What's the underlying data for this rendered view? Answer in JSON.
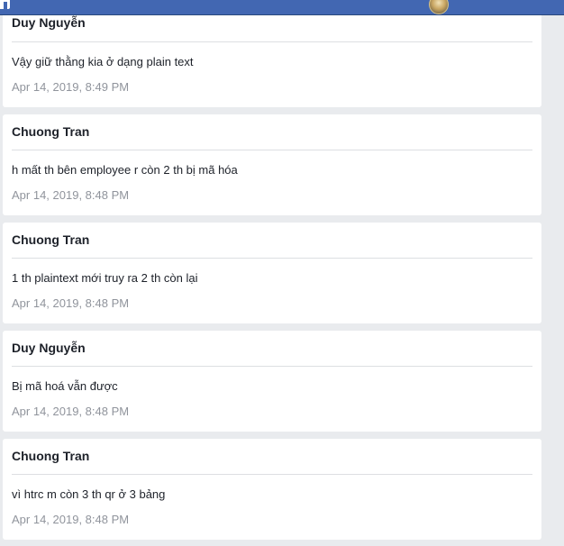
{
  "header": {
    "logo_icon": "facebook-logo-icon",
    "avatar_icon": "profile-avatar-icon"
  },
  "messages": [
    {
      "author": "Duy Nguyễn",
      "text": "Vậy giữ thằng kia ở dạng plain text",
      "timestamp": "Apr 14, 2019, 8:49 PM"
    },
    {
      "author": "Chuong Tran",
      "text": "h mất th bên employee r còn 2 th bị mã hóa",
      "timestamp": "Apr 14, 2019, 8:48 PM"
    },
    {
      "author": "Chuong Tran",
      "text": "1 th plaintext mới truy ra 2 th còn lại",
      "timestamp": "Apr 14, 2019, 8:48 PM"
    },
    {
      "author": "Duy Nguyễn",
      "text": "Bị mã hoá vẫn được",
      "timestamp": "Apr 14, 2019, 8:48 PM"
    },
    {
      "author": "Chuong Tran",
      "text": "vì htrc m còn 3 th qr ở 3 bảng",
      "timestamp": "Apr 14, 2019, 8:48 PM"
    }
  ],
  "colors": {
    "topbar": "#4267b2",
    "background": "#e9ebee",
    "card": "#ffffff",
    "author_text": "#1d2129",
    "timestamp_text": "#90949c"
  }
}
